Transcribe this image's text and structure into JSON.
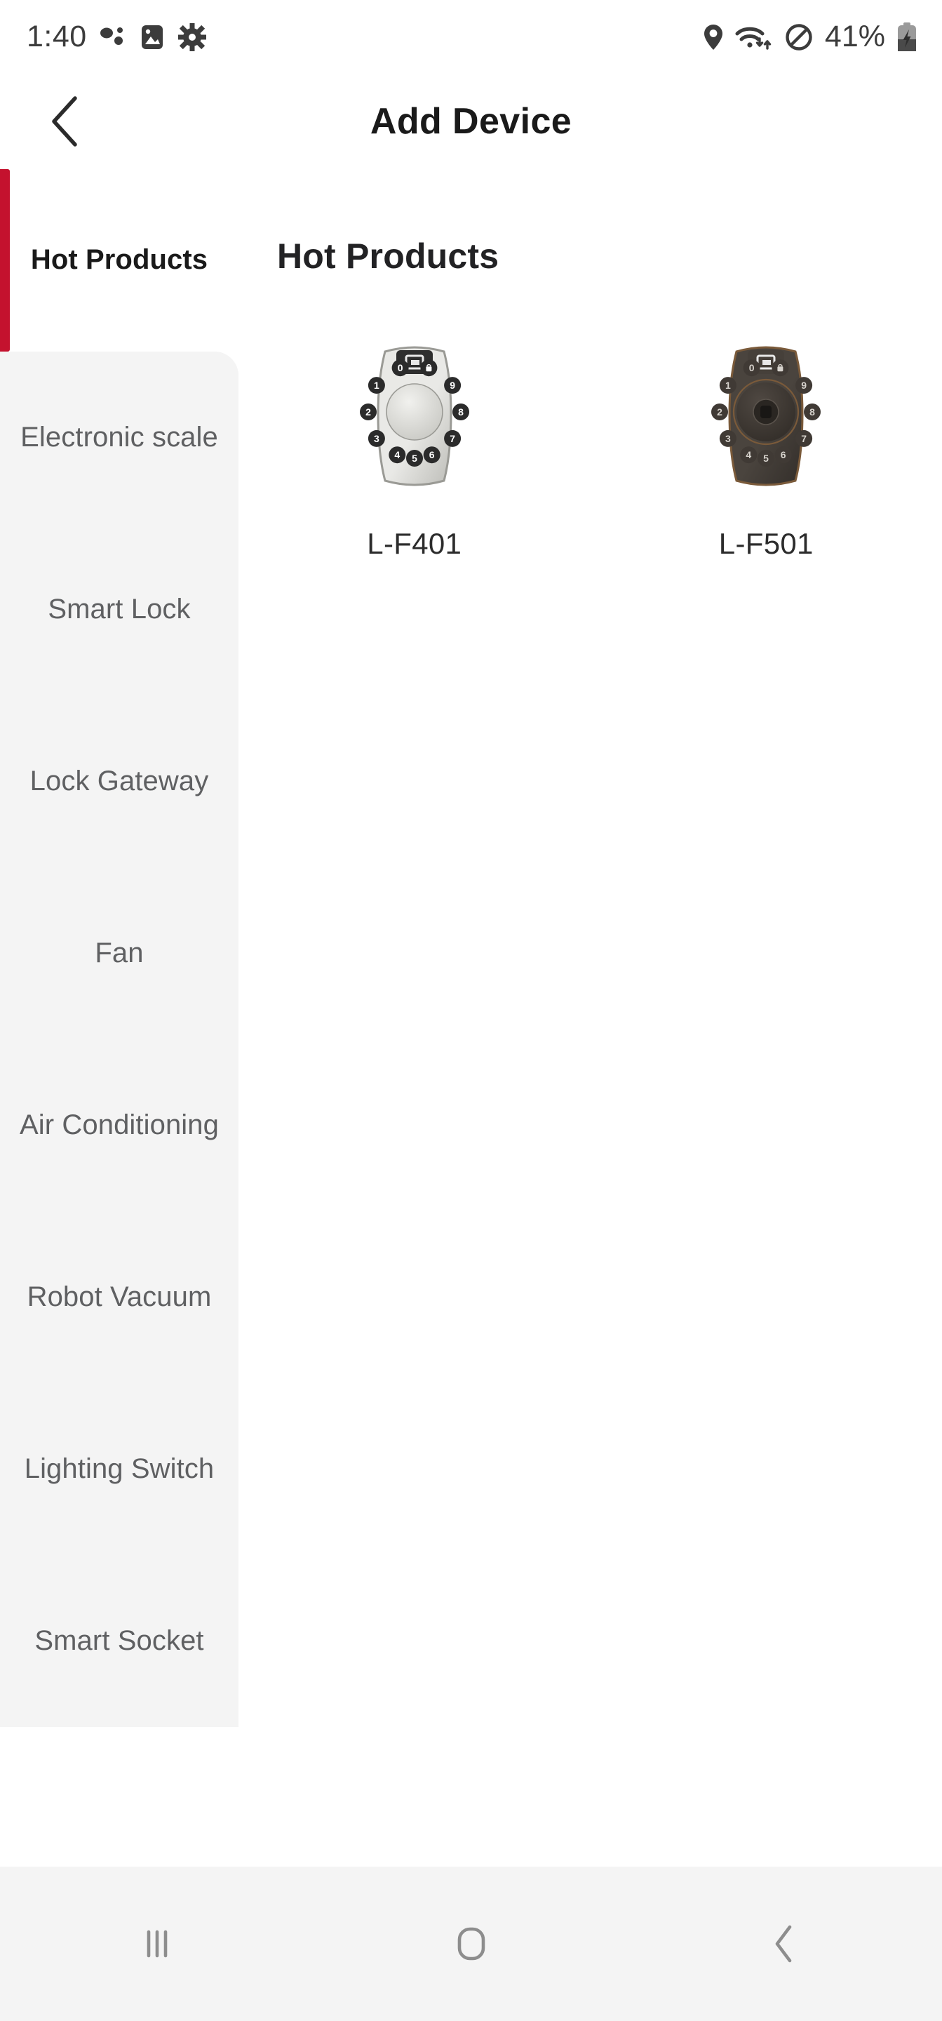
{
  "status_bar": {
    "time": "1:40",
    "battery_percent": "41%",
    "left_icons": [
      "notification-dots-icon",
      "image-icon",
      "settings-gear-icon"
    ],
    "right_icons": [
      "location-pin-icon",
      "wifi-icon",
      "do-not-disturb-icon",
      "battery-charging-icon"
    ]
  },
  "header": {
    "title": "Add Device",
    "back_icon": "chevron-left-icon"
  },
  "sidebar": {
    "items": [
      {
        "label": "Hot Products",
        "active": true
      },
      {
        "label": "Electronic scale",
        "active": false
      },
      {
        "label": "Smart Lock",
        "active": false
      },
      {
        "label": "Lock Gateway",
        "active": false
      },
      {
        "label": "Fan",
        "active": false
      },
      {
        "label": "Air Conditioning",
        "active": false
      },
      {
        "label": "Robot Vacuum",
        "active": false
      },
      {
        "label": "Lighting Switch",
        "active": false
      },
      {
        "label": "Smart Socket",
        "active": false
      }
    ]
  },
  "main": {
    "heading": "Hot Products",
    "products": [
      {
        "name": "L-F401",
        "finish": "silver",
        "icon": "smart-lock-keypad-icon"
      },
      {
        "name": "L-F501",
        "finish": "bronze",
        "icon": "smart-lock-keypad-icon"
      }
    ]
  },
  "nav_bar": {
    "buttons": [
      {
        "name": "recents",
        "icon": "recents-icon"
      },
      {
        "name": "home",
        "icon": "home-icon"
      },
      {
        "name": "back",
        "icon": "back-chevron-icon"
      }
    ]
  },
  "colors": {
    "accent_red": "#c4122e",
    "sidebar_bg": "#f4f4f4",
    "navbar_bg": "#f4f4f4",
    "text_primary": "#1a1a1a",
    "text_muted": "#5f6062"
  }
}
